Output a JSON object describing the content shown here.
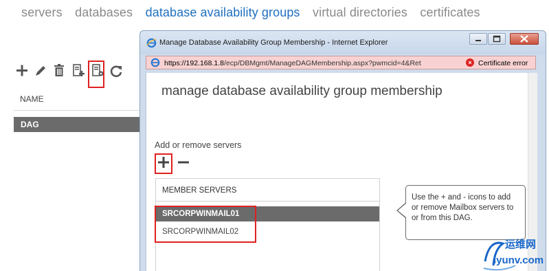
{
  "topnav": {
    "items": [
      "servers",
      "databases",
      "database availability groups",
      "virtual directories",
      "certificates"
    ],
    "active_index": 2
  },
  "toolbar": {
    "icons": [
      "add-icon",
      "edit-icon",
      "delete-icon",
      "new-database-icon",
      "manage-membership-icon",
      "refresh-icon"
    ]
  },
  "list": {
    "column_header": "NAME",
    "rows": [
      "DAG"
    ]
  },
  "window": {
    "title": "Manage Database Availability Group Membership - Internet Explorer",
    "address_host": "https://192.168.1.8",
    "address_path": "/ecp/DBMgmt/ManageDAGMembership.aspx?pwmcid=4&Ret",
    "cert_error": "Certificate error"
  },
  "dialog": {
    "title": "manage database availability group membership",
    "section_label": "Add or remove servers",
    "add_symbol": "+",
    "remove_symbol": "−",
    "member_header": "MEMBER SERVERS",
    "members": [
      "SRCORPWINMAIL01",
      "SRCORPWINMAIL02"
    ],
    "selected_index": 0
  },
  "tooltip": {
    "text": "Use the + and - icons to add or remove Mailbox servers to or from this DAG."
  },
  "watermark": {
    "line1": "运维网",
    "line2": "iyunv.com"
  },
  "colors": {
    "accent": "#1f6fc0",
    "highlight": "#e02020",
    "selected_row": "#6b6b6b"
  }
}
